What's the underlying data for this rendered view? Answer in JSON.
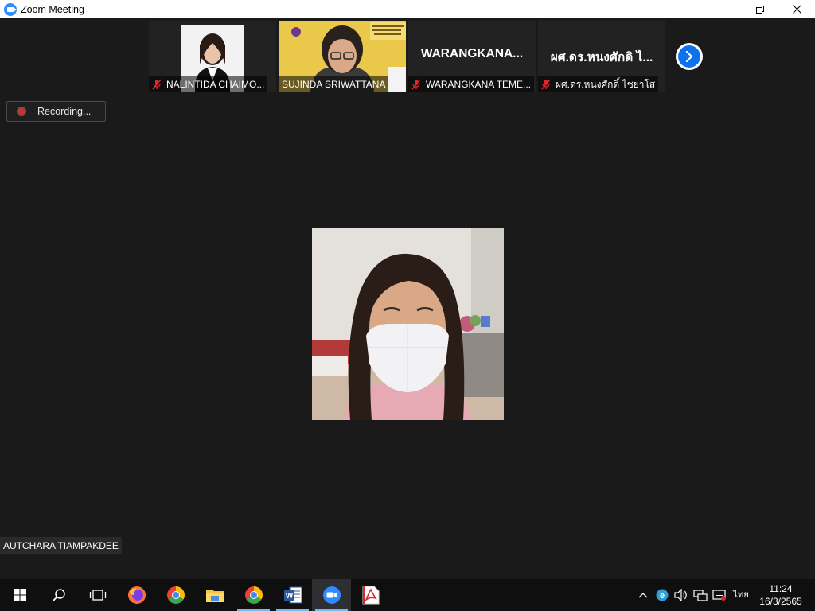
{
  "window": {
    "title": "Zoom Meeting"
  },
  "participants": [
    {
      "name": "NALINTIDA CHAIMO...",
      "display": "photo",
      "muted": true
    },
    {
      "name": "SUJINDA SRIWATTANA",
      "display": "video",
      "muted": false
    },
    {
      "name": "WARANGKANA TEME...",
      "display": "name",
      "big_name": "WARANGKANA...",
      "muted": true
    },
    {
      "name": "ผศ.ดร.หนงศักดิ์ ไชยาโส",
      "display": "name",
      "big_name": "ผศ.ดร.หนงศักดิ ไ...",
      "muted": true
    }
  ],
  "recording": {
    "label": "Recording..."
  },
  "active_speaker": {
    "name": "AUTCHARA TIAMPAKDEE"
  },
  "taskbar": {
    "apps": [
      "start-icon",
      "search-icon",
      "task-view-icon",
      "firefox-icon",
      "chrome-icon",
      "file-explorer-icon",
      "chrome-icon",
      "word-icon",
      "zoom-icon",
      "acrobat-icon"
    ],
    "language": "ไทย",
    "time": "11:24",
    "date": "16/3/2565"
  },
  "colors": {
    "background": "#1a1a1a",
    "zoom_blue": "#2d8cff",
    "mute_red": "#e02828"
  }
}
